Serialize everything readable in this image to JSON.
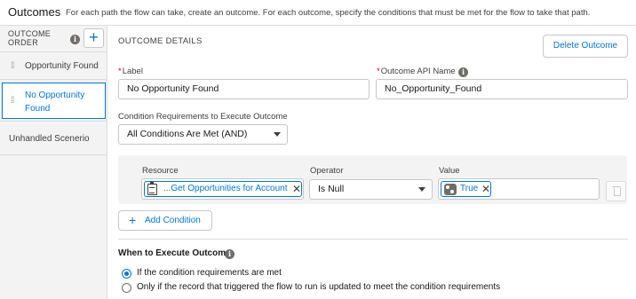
{
  "header": {
    "title": "Outcomes",
    "description": "For each path the flow can take, create an outcome. For each outcome, specify the conditions that must be met for the flow to take that path."
  },
  "sidebar": {
    "order_label": "OUTCOME ORDER",
    "add_symbol": "+",
    "items": [
      {
        "label": "Opportunity Found"
      },
      {
        "label": "No Opportunity Found",
        "selected": true
      },
      {
        "label": "Unhandled Scenerio"
      }
    ]
  },
  "details": {
    "section_title": "OUTCOME DETAILS",
    "delete_label": "Delete Outcome",
    "label_field": {
      "label": "Label",
      "required_mark": "*",
      "value": "No Opportunity Found"
    },
    "api_field": {
      "label": "Outcome API Name",
      "required_mark": "*",
      "value": "No_Opportunity_Found"
    },
    "condition_requirements": {
      "label": "Condition Requirements to Execute Outcome",
      "value": "All Conditions Are Met (AND)"
    },
    "condition": {
      "resource_label": "Resource",
      "resource_value": "...Get Opportunities for Account",
      "operator_label": "Operator",
      "operator_value": "Is Null",
      "value_label": "Value",
      "value_value": "True"
    },
    "add_condition_label": "Add Condition",
    "when_label": "When to Execute Outcome",
    "radio_options": [
      {
        "label": "If the condition requirements are met",
        "checked": true
      },
      {
        "label": "Only if the record that triggered the flow to run is updated to meet the condition requirements",
        "checked": false
      }
    ]
  },
  "icons": {
    "info": "info-icon",
    "grip": "drag-handle-icon",
    "resource": "clipboard-icon",
    "value": "toggle-icon",
    "remove": "close-icon",
    "delete_row": "trash-icon",
    "dropdown": "chevron-down-icon"
  },
  "colors": {
    "brand": "#0176d3",
    "required": "#ba0517",
    "sidebar_bg": "#f3f3f3",
    "border": "#c9c7c5"
  }
}
